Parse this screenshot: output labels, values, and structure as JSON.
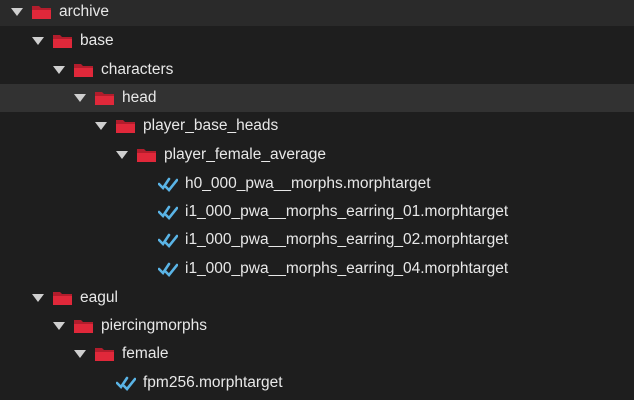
{
  "tree": {
    "nodes": [
      {
        "label": "archive",
        "type": "folder",
        "expanded": true
      },
      {
        "label": "base",
        "type": "folder",
        "expanded": true
      },
      {
        "label": "characters",
        "type": "folder",
        "expanded": true
      },
      {
        "label": "head",
        "type": "folder",
        "expanded": true,
        "selected": true
      },
      {
        "label": "player_base_heads",
        "type": "folder",
        "expanded": true
      },
      {
        "label": "player_female_average",
        "type": "folder",
        "expanded": true
      },
      {
        "label": "h0_000_pwa__morphs.morphtarget",
        "type": "file"
      },
      {
        "label": "i1_000_pwa__morphs_earring_01.morphtarget",
        "type": "file"
      },
      {
        "label": "i1_000_pwa__morphs_earring_02.morphtarget",
        "type": "file"
      },
      {
        "label": "i1_000_pwa__morphs_earring_04.morphtarget",
        "type": "file"
      },
      {
        "label": "eagul",
        "type": "folder",
        "expanded": true
      },
      {
        "label": "piercingmorphs",
        "type": "folder",
        "expanded": true
      },
      {
        "label": "female",
        "type": "folder",
        "expanded": true
      },
      {
        "label": "fpm256.morphtarget",
        "type": "file"
      }
    ]
  },
  "colors": {
    "background": "#1e1e1e",
    "selected_row": "#323232",
    "text": "#e8e8e8",
    "caret": "#cfcfcf",
    "folder_icon": "#e0283a",
    "file_icon": "#5ab4e6"
  }
}
